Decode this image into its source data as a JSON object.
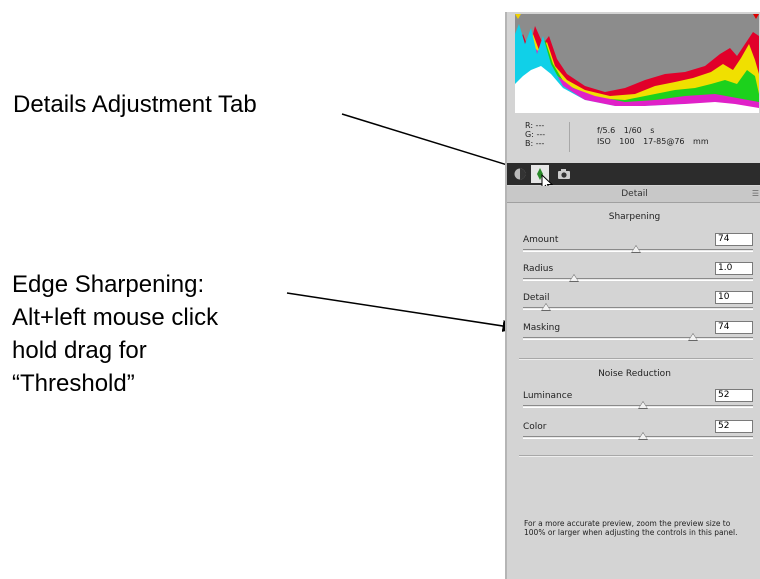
{
  "annotations": {
    "details_tab": "Details Adjustment Tab",
    "edge_lines": [
      "Edge Sharpening:",
      "Alt+left mouse click",
      "hold drag for",
      "“Threshold”"
    ]
  },
  "info": {
    "r": "R:  ---",
    "g": "G:  ---",
    "b": "B:  ---",
    "aperture_shutter": "f/5.6  1/60 s",
    "iso_lens": "ISO 100  17-85@76 mm"
  },
  "panel": {
    "title": "Detail",
    "sharpening": {
      "title": "Sharpening",
      "sliders": [
        {
          "label": "Amount",
          "value": "74",
          "position": 0.49
        },
        {
          "label": "Radius",
          "value": "1.0",
          "position": 0.22
        },
        {
          "label": "Detail",
          "value": "10",
          "position": 0.1
        },
        {
          "label": "Masking",
          "value": "74",
          "position": 0.74
        }
      ]
    },
    "noise_reduction": {
      "title": "Noise Reduction",
      "sliders": [
        {
          "label": "Luminance",
          "value": "52",
          "position": 0.52
        },
        {
          "label": "Color",
          "value": "52",
          "position": 0.52
        }
      ]
    },
    "note": "For a more accurate preview, zoom the preview size to 100% or larger when adjusting the controls in this panel."
  },
  "colors": {
    "panel_bg": "#d4d4d4",
    "tabbar_bg": "#2c2c2c",
    "histogram_bg": "#8a8a8a"
  },
  "icons": [
    "basic-tab-icon",
    "detail-tab-icon",
    "camera-calibration-icon",
    "panel-menu-icon",
    "cursor-icon"
  ]
}
